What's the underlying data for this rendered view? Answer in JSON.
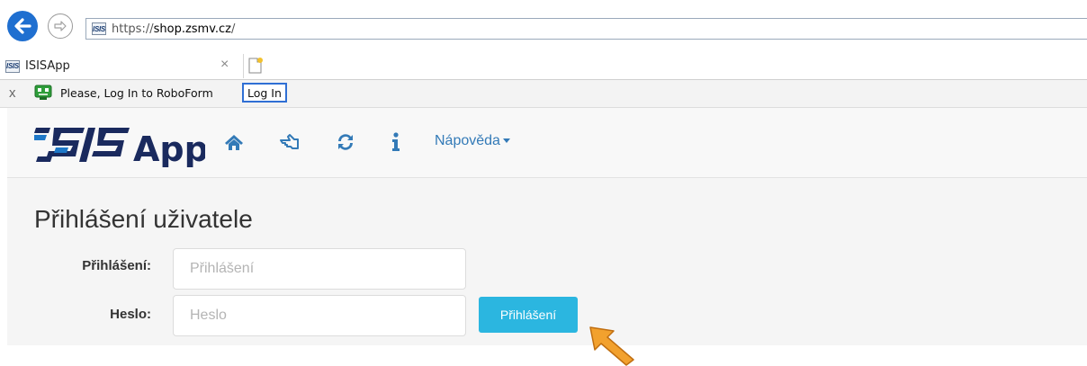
{
  "browser": {
    "url_prefix": "https://",
    "url_host": "shop.zsmv.cz",
    "url_suffix": "/",
    "favicon_text": "ISIS",
    "tab_title": "ISISApp",
    "tab_close": "×"
  },
  "roboform": {
    "close_label": "x",
    "message": "Please, Log In to RoboForm",
    "login_label": "Log In"
  },
  "app": {
    "logo_text": "ISIS App",
    "nav_icons": [
      "home-icon",
      "hand-pointer-icon",
      "refresh-icon",
      "info-icon"
    ],
    "help_menu": "Nápověda",
    "accent_color": "#337ab7"
  },
  "login_form": {
    "title": "Přihlášení uživatele",
    "username_label": "Přihlášení:",
    "username_placeholder": "Přihlášení",
    "username_value": "",
    "password_label": "Heslo:",
    "password_placeholder": "Heslo",
    "password_value": "",
    "submit_label": "Přihlášení",
    "button_color": "#2bb6e0"
  }
}
